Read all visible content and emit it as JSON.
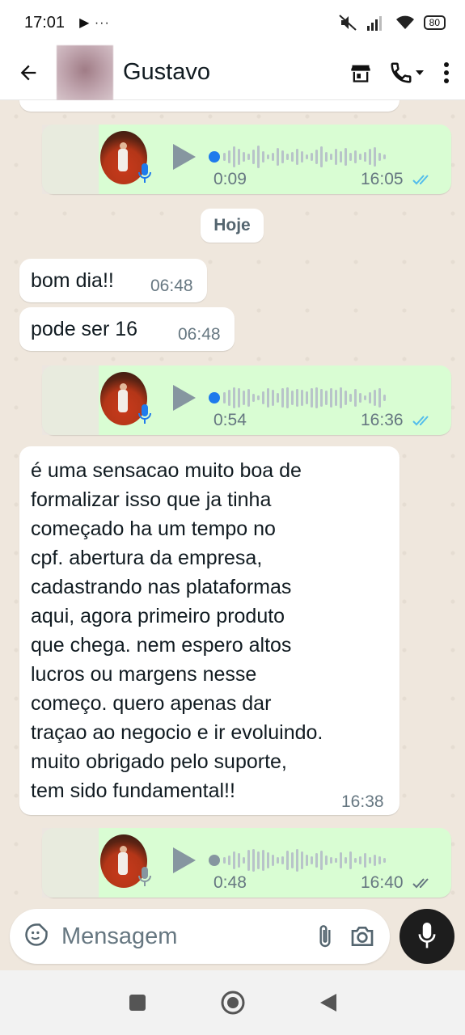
{
  "status_bar": {
    "time": "17:01",
    "extra": "▶ ···",
    "battery": "80"
  },
  "header": {
    "contact_name": "Gustavo"
  },
  "day_separator": "Hoje",
  "voice_messages": [
    {
      "duration": "0:09",
      "time": "16:05"
    },
    {
      "duration": "0:54",
      "time": "16:36"
    },
    {
      "duration": "0:48",
      "time": "16:40"
    }
  ],
  "messages": [
    {
      "text": "bom dia!!",
      "time": "06:48"
    },
    {
      "text": "pode ser 16",
      "time": "06:48"
    },
    {
      "lines": [
        "é uma sensacao muito boa de",
        "formalizar isso que ja tinha",
        "começado ha um tempo no",
        "cpf. abertura da empresa,",
        "cadastrando nas plataformas",
        "aqui, agora primeiro produto",
        "que chega. nem espero altos",
        "lucros ou margens nesse",
        "começo. quero apenas dar",
        "traçao ao negocio e ir evoluindo.",
        "muito obrigado pelo suporte,",
        "tem sido fundamental!!"
      ],
      "time": "16:38"
    }
  ],
  "composer": {
    "placeholder": "Mensagem"
  },
  "colors": {
    "outgoing": "#d9fdd3",
    "incoming": "#ffffff",
    "read_tick": "#53bdeb",
    "background": "#efe7dd"
  },
  "icons": [
    "back-arrow-icon",
    "store-icon",
    "phone-icon",
    "chevron-down-icon",
    "more-vert-icon",
    "play-icon",
    "mic-icon",
    "double-check-icon",
    "sticker-icon",
    "attach-icon",
    "camera-icon",
    "square-nav-icon",
    "home-nav-icon",
    "back-nav-icon"
  ]
}
